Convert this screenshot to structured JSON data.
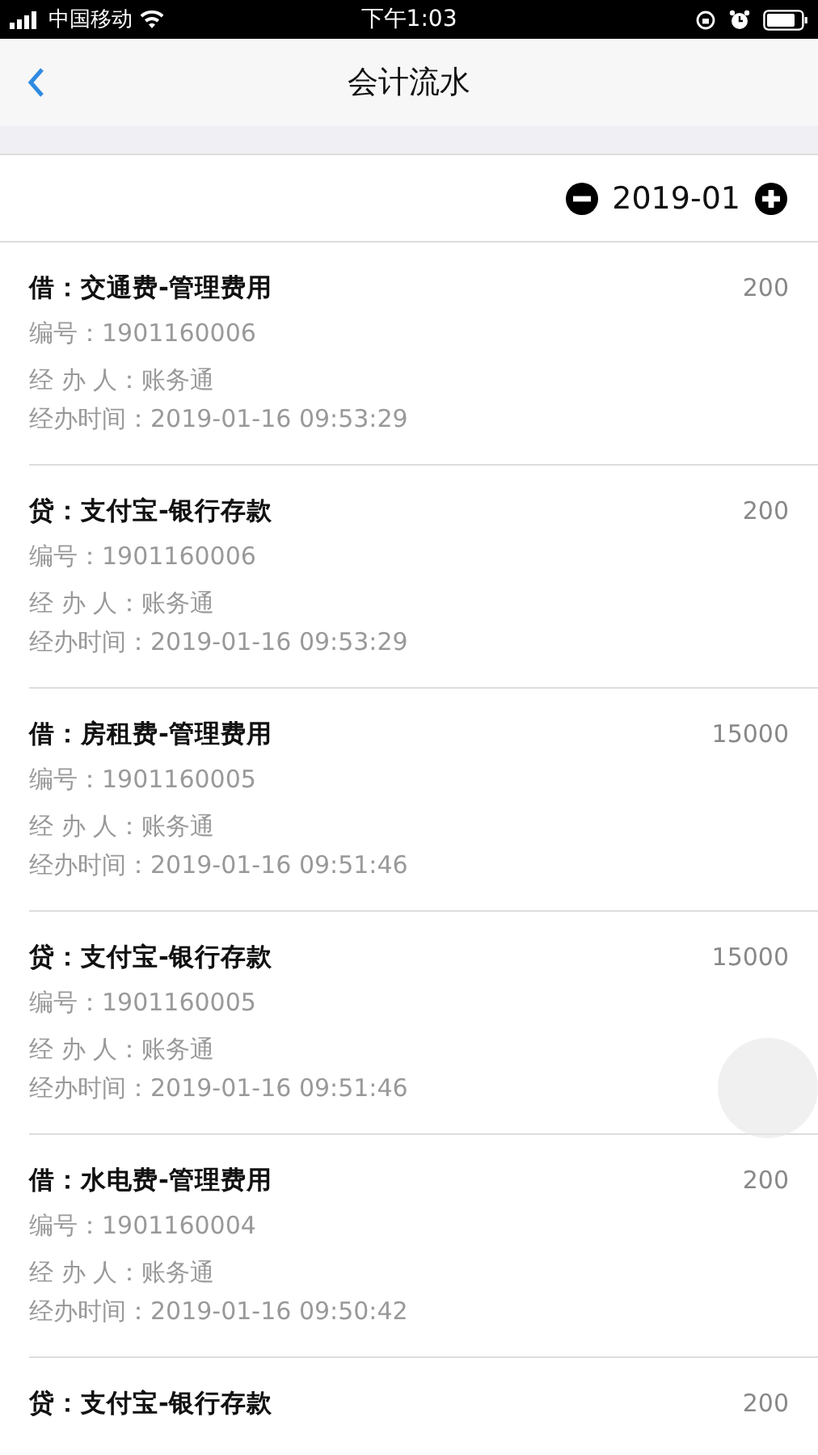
{
  "status_bar": {
    "carrier": "中国移动",
    "time": "下午1:03"
  },
  "nav": {
    "title": "会计流水"
  },
  "period": {
    "value": "2019-01"
  },
  "entries": [
    {
      "title": "借：交通费-管理费用",
      "amount": "200",
      "number": "编号：1901160006",
      "handler": "经 办 人：账务通",
      "time": "经办时间：2019-01-16 09:53:29"
    },
    {
      "title": "贷：支付宝-银行存款",
      "amount": "200",
      "number": "编号：1901160006",
      "handler": "经 办 人：账务通",
      "time": "经办时间：2019-01-16 09:53:29"
    },
    {
      "title": "借：房租费-管理费用",
      "amount": "15000",
      "number": "编号：1901160005",
      "handler": "经 办 人：账务通",
      "time": "经办时间：2019-01-16 09:51:46"
    },
    {
      "title": "贷：支付宝-银行存款",
      "amount": "15000",
      "number": "编号：1901160005",
      "handler": "经 办 人：账务通",
      "time": "经办时间：2019-01-16 09:51:46"
    },
    {
      "title": "借：水电费-管理费用",
      "amount": "200",
      "number": "编号：1901160004",
      "handler": "经 办 人：账务通",
      "time": "经办时间：2019-01-16 09:50:42"
    },
    {
      "title": "贷：支付宝-银行存款",
      "amount": "200"
    }
  ]
}
